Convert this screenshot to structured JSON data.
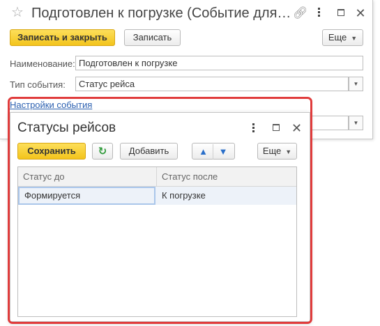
{
  "window": {
    "title": "Подготовлен к погрузке (Событие для…",
    "star_icon": "☆",
    "link_icon": "🔗"
  },
  "toolbar": {
    "save_close_label": "Записать и закрыть",
    "save_label": "Записать",
    "more_label": "Еще"
  },
  "form": {
    "name_label": "Наименование:",
    "name_value": "Подготовлен к погрузке",
    "event_type_label": "Тип события:",
    "event_type_value": "Статус рейса",
    "settings_link": "Настройки события"
  },
  "dialog": {
    "title": "Статусы рейсов",
    "save_label": "Сохранить",
    "add_label": "Добавить",
    "more_label": "Еще",
    "columns": [
      "Статус до",
      "Статус после"
    ],
    "rows": [
      [
        "Формируется",
        "К погрузке"
      ]
    ]
  },
  "colors": {
    "accent_yellow": "#f3c41c",
    "highlight_red": "#e03c3c",
    "link_blue": "#2a5fb0",
    "refresh_green": "#2f9a3a",
    "arrow_blue": "#2a6fc9"
  }
}
